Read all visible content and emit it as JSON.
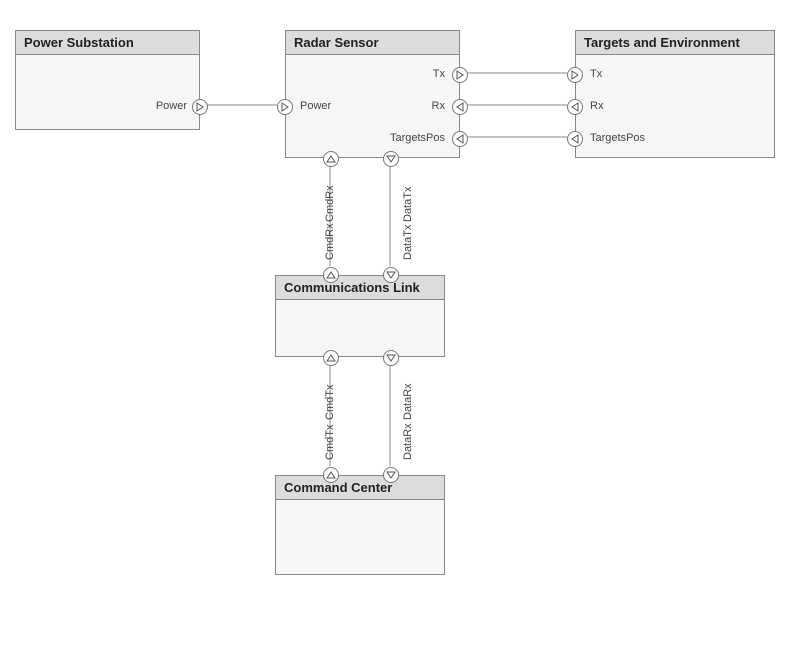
{
  "blocks": {
    "power_substation": {
      "title": "Power Substation",
      "ports": {
        "power_out": "Power"
      }
    },
    "radar_sensor": {
      "title": "Radar Sensor",
      "ports": {
        "power_in": "Power",
        "tx": "Tx",
        "rx": "Rx",
        "targets_pos": "TargetsPos",
        "cmd_rx": "CmdRx",
        "data_tx": "DataTx"
      }
    },
    "targets_env": {
      "title": "Targets and Environment",
      "ports": {
        "tx": "Tx",
        "rx": "Rx",
        "targets_pos": "TargetsPos"
      }
    },
    "comm_link": {
      "title": "Communications Link",
      "ports": {
        "cmd_rx_top": "CmdRx",
        "data_tx_top": "DataTx",
        "cmd_tx_bot": "CmdTx",
        "data_rx_bot": "DataRx"
      }
    },
    "command_center": {
      "title": "Command Center",
      "ports": {
        "cmd_tx": "CmdTx",
        "data_rx": "DataRx"
      }
    }
  }
}
